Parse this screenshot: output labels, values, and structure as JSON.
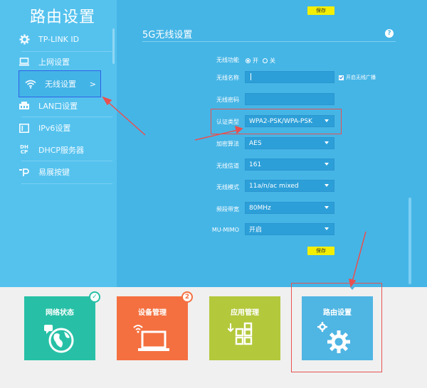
{
  "sidebar": {
    "title": "路由设置",
    "items": [
      {
        "label": "TP-LINK ID",
        "icon": "gear-icon"
      },
      {
        "label": "上网设置",
        "icon": "monitor-icon"
      },
      {
        "label": "无线设置",
        "icon": "wifi-icon",
        "chevron": ">"
      },
      {
        "label": "LAN口设置",
        "icon": "lan-icon"
      },
      {
        "label": "IPv6设置",
        "icon": "ipv6-icon"
      },
      {
        "label": "DHCP服务器",
        "icon": "dhcp-icon",
        "icon_text": "DH CP"
      },
      {
        "label": "易展按键",
        "icon": "easymesh-icon",
        "icon_text": "‾P"
      }
    ]
  },
  "content": {
    "save_label_top": "保存",
    "section_title": "5G无线设置",
    "help": "?",
    "fields": {
      "wireless_function": {
        "label": "无线功能",
        "on": "开",
        "off": "关",
        "selected": "开"
      },
      "ssid": {
        "label": "无线名称",
        "value": "",
        "hide_label": "开启无线广播"
      },
      "password": {
        "label": "无线密码",
        "value": ""
      },
      "auth_type": {
        "label": "认证类型",
        "value": "WPA2-PSK/WPA-PSK"
      },
      "encryption": {
        "label": "加密算法",
        "value": "AES"
      },
      "channel": {
        "label": "无线信道",
        "value": "161"
      },
      "mode": {
        "label": "无线模式",
        "value": "11a/n/ac mixed"
      },
      "bandwidth": {
        "label": "频段带宽",
        "value": "80MHz"
      },
      "mumimo": {
        "label": "MU-MIMO",
        "value": "开启"
      }
    },
    "save_label_bottom": "保存"
  },
  "tiles": [
    {
      "label": "网络状态",
      "color": "#27c0a6",
      "badge": "✓",
      "badge_color": "#27c0a6",
      "icon": "globe-icon"
    },
    {
      "label": "设备管理",
      "color": "#f47040",
      "badge": "2",
      "badge_color": "#f47040",
      "icon": "laptop-wifi-icon"
    },
    {
      "label": "应用管理",
      "color": "#b4c83c",
      "icon": "apps-grid-icon"
    },
    {
      "label": "路由设置",
      "color": "#4fb5e3",
      "icon": "settings-gears-icon"
    }
  ],
  "colors": {
    "sidebar_bg": "#55c2ee",
    "content_bg": "#45b5e6",
    "save_button": "#f4ef00",
    "highlight_red": "#e85050",
    "active_border": "#2f61e8"
  }
}
